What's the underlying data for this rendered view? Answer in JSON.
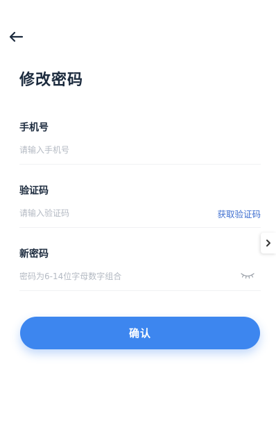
{
  "header": {
    "back_icon": "arrow-left-icon",
    "title": "修改密码"
  },
  "form": {
    "phone": {
      "label": "手机号",
      "value": "",
      "placeholder": "请输入手机号"
    },
    "code": {
      "label": "验证码",
      "value": "",
      "placeholder": "请输入验证码",
      "action_label": "获取验证码"
    },
    "password": {
      "label": "新密码",
      "value": "",
      "placeholder": "密码为6-14位字母数字组合",
      "toggle_icon": "eye-closed-icon"
    }
  },
  "side_tab": {
    "icon": "chevron-right-icon"
  },
  "confirm_button": {
    "label": "确认"
  },
  "colors": {
    "accent": "#3d86ef",
    "link": "#3f6fd0",
    "title": "#1b2a3d",
    "placeholder": "#b4bac3"
  }
}
